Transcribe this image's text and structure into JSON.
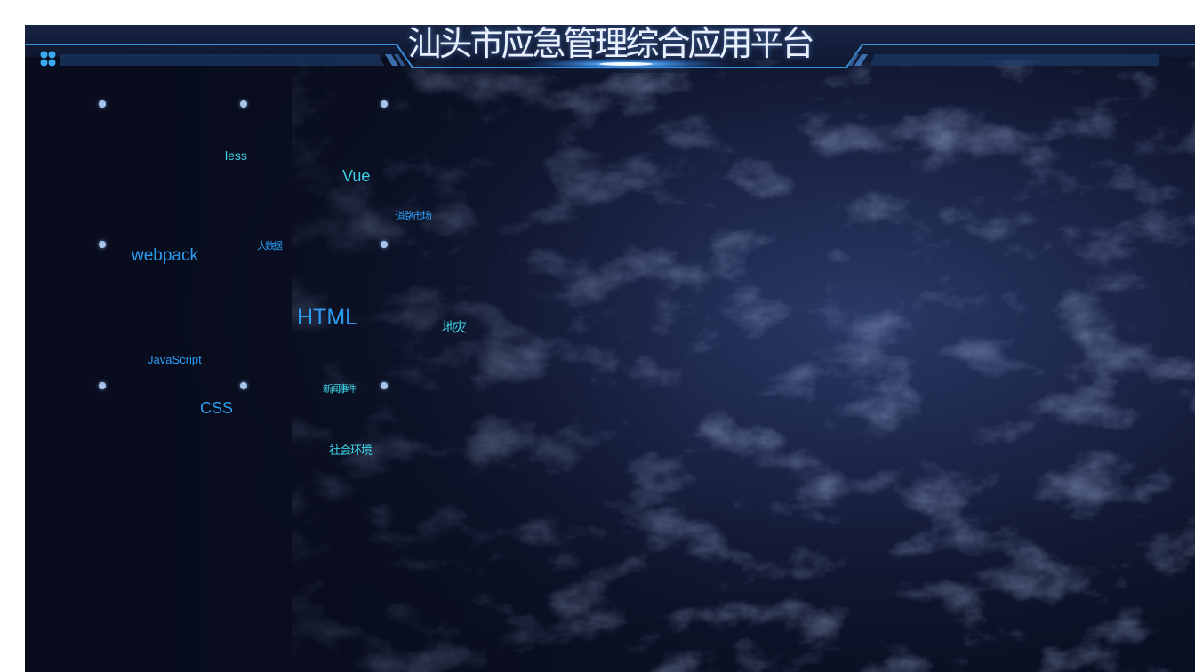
{
  "app": {
    "title": "汕头市应急管理综合应用平台",
    "menu_icon": "app-grid-icon"
  },
  "colors": {
    "background": "#0a0f22",
    "header_line": "#3a8fd6",
    "title_text": "#e9f1ff",
    "tag_cyan": "#3fd3e6",
    "tag_blue": "#2b9cf0"
  },
  "tag_cloud": {
    "tags": [
      {
        "id": "less",
        "text": "less"
      },
      {
        "id": "vue",
        "text": "Vue"
      },
      {
        "id": "tag-a",
        "text": "道路市场"
      },
      {
        "id": "webpack",
        "text": "webpack"
      },
      {
        "id": "tag-b",
        "text": "大数据"
      },
      {
        "id": "html",
        "text": "HTML"
      },
      {
        "id": "tag-c",
        "text": "地灾"
      },
      {
        "id": "javascript",
        "text": "JavaScript"
      },
      {
        "id": "css",
        "text": "CSS"
      },
      {
        "id": "tag-d",
        "text": "新闻事件"
      },
      {
        "id": "tag-e",
        "text": "社会环境"
      }
    ]
  }
}
